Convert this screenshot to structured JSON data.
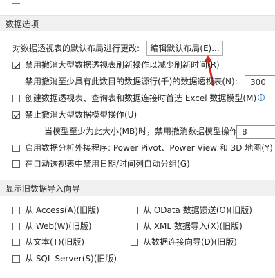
{
  "data_options": {
    "section_title": "数据选项",
    "layout_label": "对数据透视表的默认布局进行更改:",
    "edit_layout_button": "编辑默认布局(E)...",
    "options": [
      {
        "label": "禁用撤消大型数据透视表刷新操作以减少刷新时间(R)",
        "checked": true
      },
      {
        "label": "禁用撤消至少具有此数目的数据源行(千)的数据透视表(N):",
        "value": "300"
      },
      {
        "label": "创建数据透视表、查询表和数据连接时首选 Excel 数据模型(M)",
        "checked": false
      },
      {
        "label": "禁止撤消大型数据模型操作(U)",
        "checked": true
      },
      {
        "label": "当模型至少为此大小(MB)时，禁用撤消数据模型操作(L):",
        "value": "8"
      },
      {
        "label": "启用数据分析外接程序: Power Pivot、Power View 和 3D 地图(Y)",
        "checked": false
      },
      {
        "label": "在自动透视表中禁用日期/时间列自动分组(G)",
        "checked": false
      }
    ]
  },
  "legacy_import": {
    "section_title": "显示旧数据导入向导",
    "items": [
      {
        "label": "从 Access(A)(旧版)",
        "checked": false
      },
      {
        "label": "从 OData 数据馈送(O)(旧版)",
        "checked": false
      },
      {
        "label": "从 Web(W)(旧版)",
        "checked": false
      },
      {
        "label": "从 XML 数据导入(X)(旧版)",
        "checked": false
      },
      {
        "label": "从文本(T)(旧版)",
        "checked": false
      },
      {
        "label": "从数据连接向导(D)(旧版)",
        "checked": false
      },
      {
        "label": "从 SQL Server(S)(旧版)",
        "checked": false
      }
    ]
  },
  "colors": {
    "arrow": "#d9261c",
    "info": "#3c7cc7",
    "section_bg": "#f0f0f0"
  }
}
